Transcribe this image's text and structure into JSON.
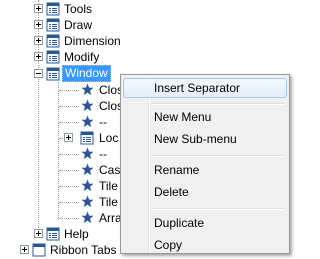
{
  "tree": {
    "items": [
      {
        "label": "Tools",
        "icon": "menu-icon",
        "expander": "plus"
      },
      {
        "label": "Draw",
        "icon": "menu-icon",
        "expander": "plus"
      },
      {
        "label": "Dimension",
        "icon": "menu-icon",
        "expander": "plus"
      },
      {
        "label": "Modify",
        "icon": "menu-icon",
        "expander": "plus"
      },
      {
        "label": "Window",
        "icon": "menu-icon",
        "expander": "minus",
        "selected": true
      },
      {
        "label": "Clos",
        "icon": "star-icon"
      },
      {
        "label": "Clos",
        "icon": "star-icon"
      },
      {
        "label": "--",
        "icon": "star-icon"
      },
      {
        "label": "Loc",
        "icon": "menu-icon",
        "expander": "plus"
      },
      {
        "label": "--",
        "icon": "star-icon"
      },
      {
        "label": "Cas",
        "icon": "star-icon"
      },
      {
        "label": "Tile",
        "icon": "star-icon"
      },
      {
        "label": "Tile",
        "icon": "star-icon"
      },
      {
        "label": "Arra",
        "icon": "star-icon"
      },
      {
        "label": "Help",
        "icon": "menu-icon",
        "expander": "plus"
      },
      {
        "label": "Ribbon Tabs",
        "icon": "ribbon-icon",
        "expander": "plus"
      }
    ]
  },
  "context_menu": {
    "items": [
      {
        "label": "Insert Separator",
        "hover": true
      },
      {
        "label": "New Menu"
      },
      {
        "label": "New Sub-menu"
      },
      {
        "label": "Rename"
      },
      {
        "label": "Delete"
      },
      {
        "label": "Duplicate"
      },
      {
        "label": "Copy"
      }
    ]
  },
  "colors": {
    "selection": "#3399ff",
    "menu_bg": "#f0f0f0",
    "menu_hover_border": "#a8c8eb",
    "icon_blue": "#2b5797"
  }
}
